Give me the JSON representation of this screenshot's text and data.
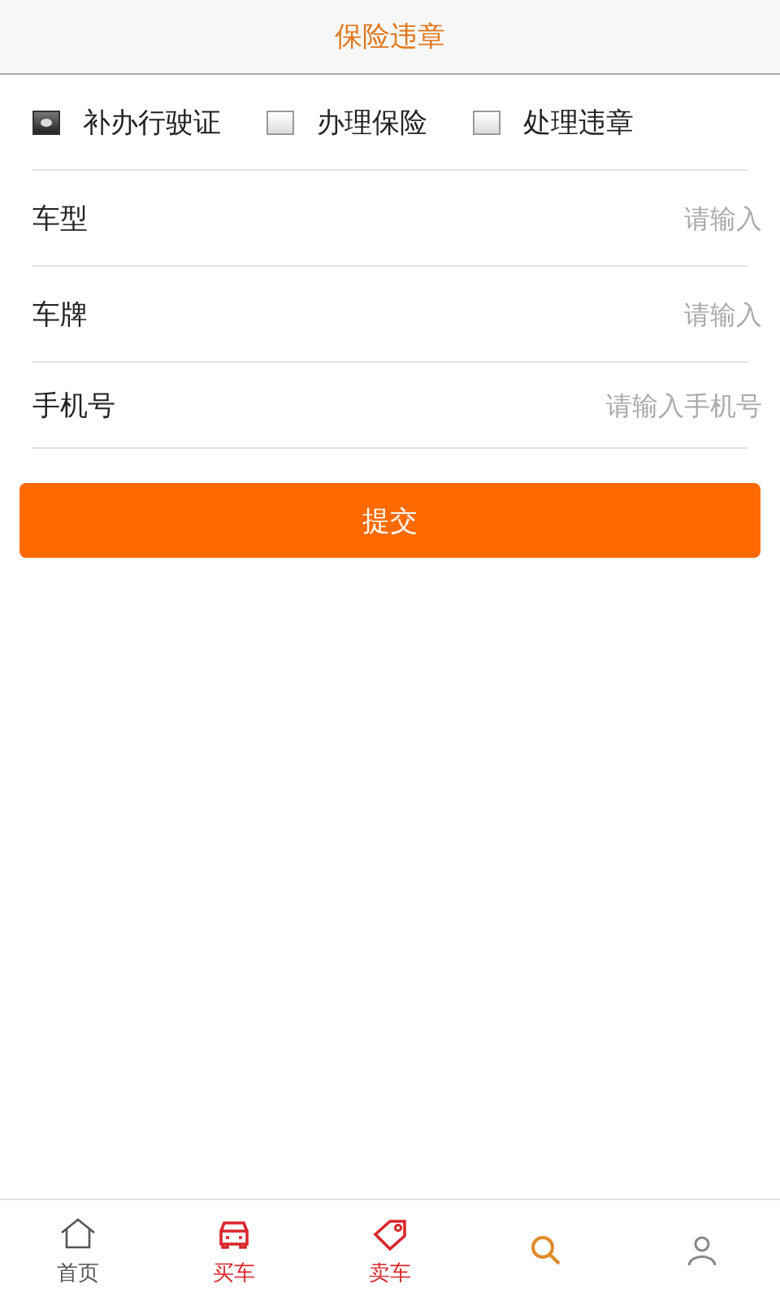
{
  "header": {
    "title": "保险违章"
  },
  "options": [
    {
      "label": "补办行驶证",
      "checked": true
    },
    {
      "label": "办理保险",
      "checked": false
    },
    {
      "label": "处理违章",
      "checked": false
    }
  ],
  "fields": [
    {
      "label": "车型",
      "placeholder": "请输入"
    },
    {
      "label": "车牌",
      "placeholder": "请输入"
    },
    {
      "label": "手机号",
      "placeholder": "请输入手机号"
    }
  ],
  "submit_button": "提交",
  "tab_bar": [
    {
      "kind": "home",
      "label": "首页",
      "color": "#555555"
    },
    {
      "kind": "car",
      "label": "买车",
      "color": "#d9262b"
    },
    {
      "kind": "tag",
      "label": "卖车",
      "color": "#d9262b"
    },
    {
      "kind": "search",
      "color": "#e08a2a"
    },
    {
      "kind": "person",
      "color": "#888888"
    }
  ]
}
